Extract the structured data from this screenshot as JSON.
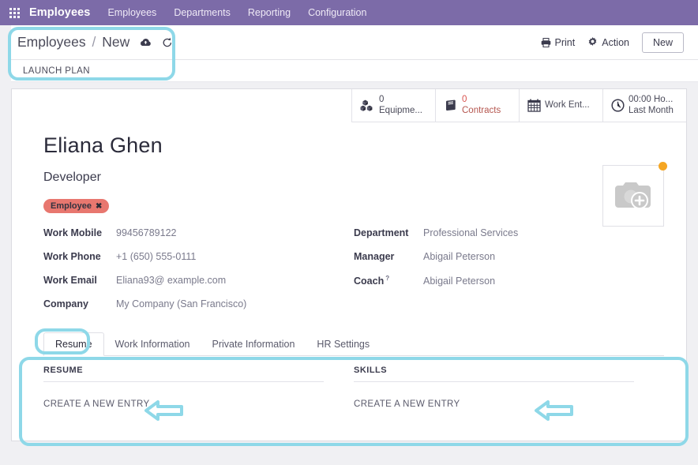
{
  "navbar": {
    "apps_icon": "apps-grid-icon",
    "brand": "Employees",
    "items": [
      {
        "label": "Employees"
      },
      {
        "label": "Departments"
      },
      {
        "label": "Reporting"
      },
      {
        "label": "Configuration"
      }
    ]
  },
  "control_panel": {
    "breadcrumb_root": "Employees",
    "breadcrumb_sep": "/",
    "breadcrumb_current": "New",
    "save_icon": "cloud-upload-icon",
    "discard_icon": "rotate-left-icon",
    "print_label": "Print",
    "print_icon": "printer-icon",
    "action_label": "Action",
    "action_icon": "gear-icon",
    "new_label": "New"
  },
  "launch_plan": {
    "label": "LAUNCH PLAN"
  },
  "stats": [
    {
      "icon": "cubes-icon",
      "count": "0",
      "label": "Equipme...",
      "count_color": "#4b4b5a"
    },
    {
      "icon": "book-icon",
      "count": "0",
      "label": "Contracts",
      "count_color": "#d9534f"
    },
    {
      "icon": "calendar-icon",
      "count": "",
      "label": "Work Ent...",
      "count_color": "#4b4b5a"
    },
    {
      "icon": "clock-icon",
      "count": "00:00 Ho...",
      "label": "Last Month",
      "count_color": "#4b4b5a"
    }
  ],
  "employee": {
    "name": "Eliana Ghen",
    "job_title": "Developer",
    "tag": "Employee",
    "tag_remove": "✖",
    "tag_color": "#e8776f",
    "avatar_icon": "camera-add-icon",
    "avatar_badge_color": "#f5a623"
  },
  "fields_left": [
    {
      "label": "Work Mobile",
      "value": "99456789122"
    },
    {
      "label": "Work Phone",
      "value": "+1 (650) 555-0111"
    },
    {
      "label": "Work Email",
      "value": "Eliana93@ example.com"
    },
    {
      "label": "Company",
      "value": "My Company (San Francisco)"
    }
  ],
  "fields_right": [
    {
      "label": "Department",
      "value": "Professional Services",
      "help": ""
    },
    {
      "label": "Manager",
      "value": "Abigail Peterson",
      "help": ""
    },
    {
      "label": "Coach",
      "value": "Abigail Peterson",
      "help": "?"
    }
  ],
  "tabs": [
    {
      "label": "Resume",
      "active": true
    },
    {
      "label": "Work Information",
      "active": false
    },
    {
      "label": "Private Information",
      "active": false
    },
    {
      "label": "HR Settings",
      "active": false
    }
  ],
  "panels": [
    {
      "title": "RESUME",
      "link": "CREATE A NEW ENTRY"
    },
    {
      "title": "SKILLS",
      "link": "CREATE A NEW ENTRY"
    }
  ],
  "annotations": {
    "highlight_color": "#8ed8e8",
    "arrow_color": "#8ed8e8"
  }
}
